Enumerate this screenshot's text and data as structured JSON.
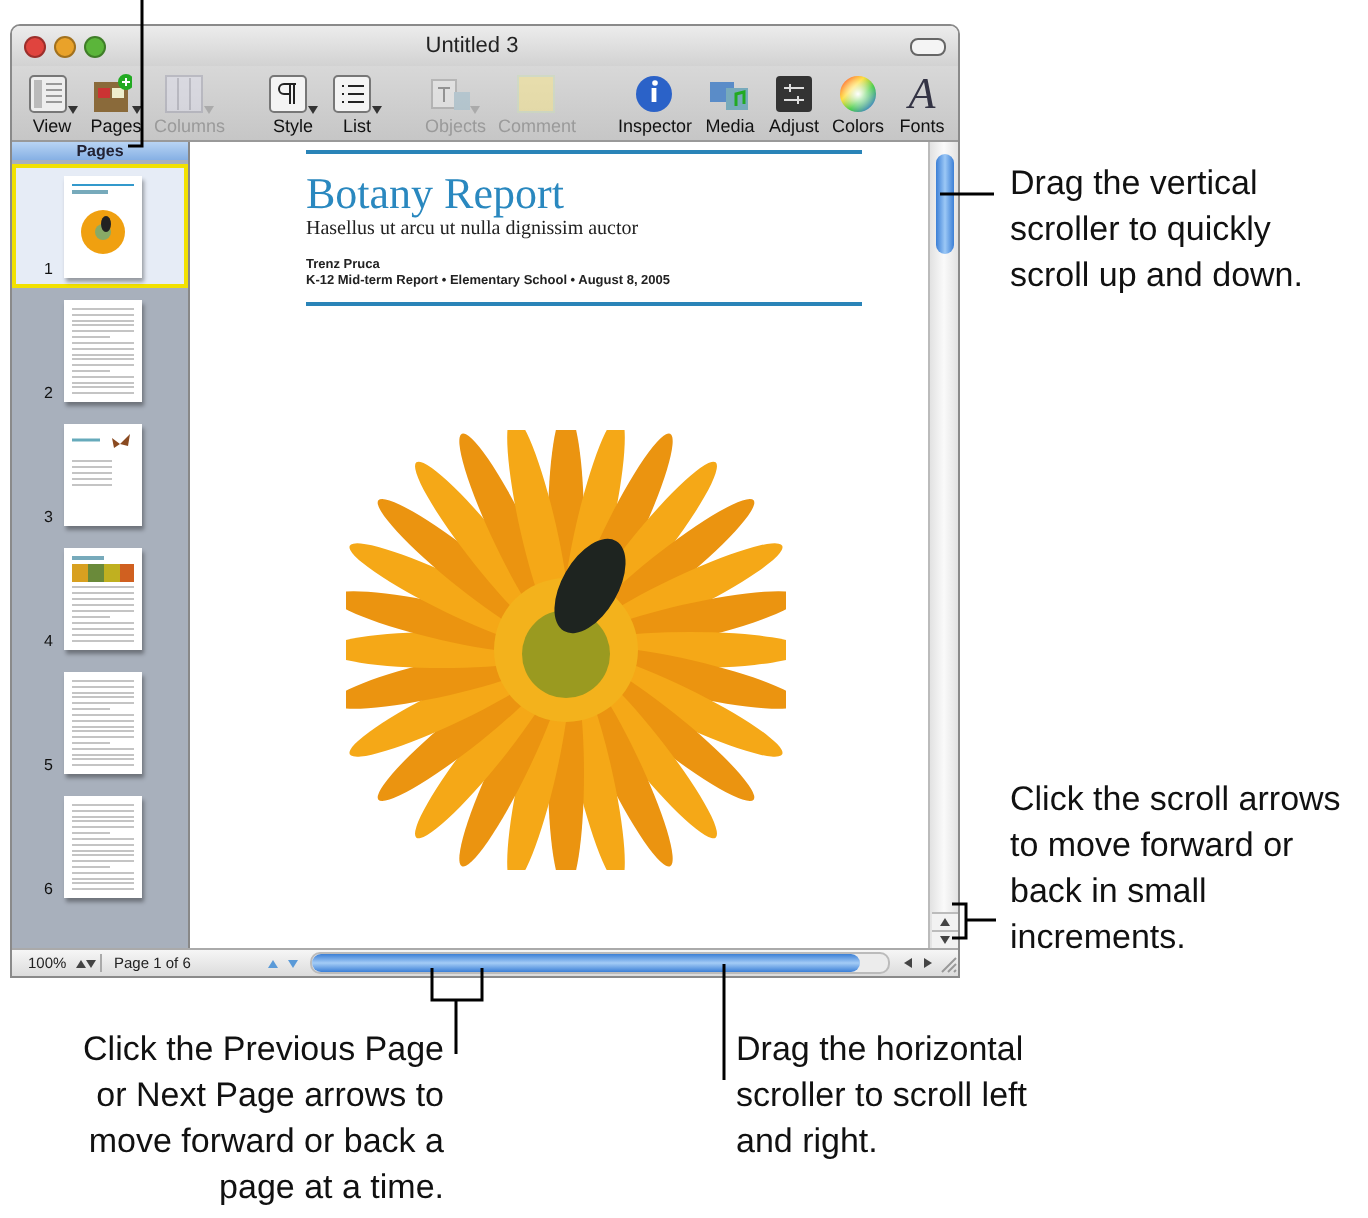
{
  "window": {
    "title": "Untitled 3"
  },
  "toolbar": {
    "groups": [
      [
        {
          "label": "View",
          "disabled": false,
          "menu": true
        },
        {
          "label": "Pages",
          "disabled": false,
          "menu": true
        },
        {
          "label": "Columns",
          "disabled": true,
          "menu": true
        }
      ],
      [
        {
          "label": "Style",
          "disabled": false,
          "menu": true
        },
        {
          "label": "List",
          "disabled": false,
          "menu": true
        }
      ],
      [
        {
          "label": "Objects",
          "disabled": true,
          "menu": true
        },
        {
          "label": "Comment",
          "disabled": true,
          "menu": false
        }
      ],
      [
        {
          "label": "Inspector",
          "disabled": false,
          "menu": false
        },
        {
          "label": "Media",
          "disabled": false,
          "menu": false
        },
        {
          "label": "Adjust",
          "disabled": false,
          "menu": false
        },
        {
          "label": "Colors",
          "disabled": false,
          "menu": false
        },
        {
          "label": "Fonts",
          "disabled": false,
          "menu": false,
          "glyph": "A"
        }
      ]
    ]
  },
  "sidebar": {
    "header": "Pages",
    "pages": [
      {
        "number": "1",
        "kind": "cover",
        "selected": true
      },
      {
        "number": "2",
        "kind": "text",
        "selected": false
      },
      {
        "number": "3",
        "kind": "contents",
        "selected": false
      },
      {
        "number": "4",
        "kind": "photos",
        "selected": false
      },
      {
        "number": "5",
        "kind": "text",
        "selected": false
      },
      {
        "number": "6",
        "kind": "text",
        "selected": false
      }
    ]
  },
  "document": {
    "title": "Botany Report",
    "subtitle": "Hasellus ut arcu ut nulla dignissim auctor",
    "author": "Trenz Pruca",
    "details": "K-12 Mid-term Report • Elementary School • August 8, 2005"
  },
  "status_bar": {
    "zoom": "100%",
    "page": "Page 1 of 6"
  },
  "callouts_right": [
    {
      "text": "Drag the vertical scroller to quickly scroll up and down."
    },
    {
      "text": "Click the scroll arrows to move forward or back in small increments."
    }
  ],
  "callouts_bottom": [
    {
      "text": "Click the Previous Page or Next Page arrows to move forward or back a page at a time."
    },
    {
      "text": "Drag the horizontal scroller to scroll left and right."
    }
  ]
}
